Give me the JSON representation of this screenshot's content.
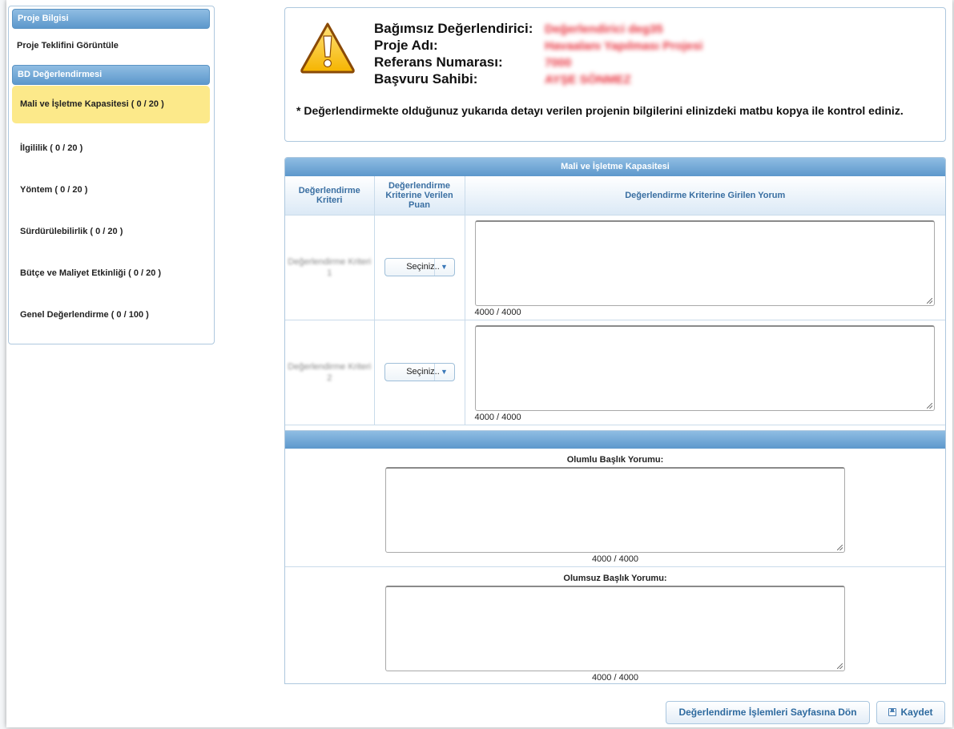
{
  "sidebar": {
    "section1_title": "Proje Bilgisi",
    "view_proposal_link": "Proje Teklifini Görüntüle",
    "section2_title": "BD Değerlendirmesi",
    "items": [
      {
        "label": "Mali ve İşletme Kapasitesi ( 0 / 20 )",
        "active": true
      },
      {
        "label": "İlgililik ( 0 / 20 )"
      },
      {
        "label": "Yöntem ( 0 / 20 )"
      },
      {
        "label": "Sürdürülebilirlik ( 0 / 20 )"
      },
      {
        "label": "Bütçe ve Maliyet Etkinliği ( 0 / 20 )"
      },
      {
        "label": "Genel Değerlendirme ( 0 / 100 )"
      }
    ]
  },
  "info": {
    "evaluator_label": "Bağımsız Değerlendirici:",
    "evaluator_value": "Değerlendirici deg35",
    "project_label": "Proje Adı:",
    "project_value": "Havaalanı Yapılması Projesi",
    "ref_label": "Referans Numarası:",
    "ref_value": "7000",
    "applicant_label": "Başvuru Sahibi:",
    "applicant_value": "AYŞE SÖNMEZ",
    "note": "* Değerlendirmekte olduğunuz yukarıda detayı verilen projenin bilgilerini elinizdeki matbu kopya ile kontrol ediniz."
  },
  "criteria": {
    "title": "Mali ve İşletme Kapasitesi",
    "col_criterion": "Değerlendirme Kriteri",
    "col_score": "Değerlendirme Kriterine Verilen Puan",
    "col_comment": "Değerlendirme Kriterine Girilen Yorum",
    "rows": [
      {
        "name": "Değerlendirme Kriteri 1",
        "select": "Seçiniz..",
        "counter": "4000 / 4000"
      },
      {
        "name": "Değerlendirme Kriteri 2",
        "select": "Seçiniz..",
        "counter": "4000 / 4000"
      }
    ]
  },
  "summary": {
    "positive_label": "Olumlu Başlık Yorumu:",
    "positive_counter": "4000 / 4000",
    "negative_label": "Olumsuz Başlık Yorumu:",
    "negative_counter": "4000 / 4000"
  },
  "buttons": {
    "back": "Değerlendirme İşlemleri Sayfasına Dön",
    "save": "Kaydet"
  },
  "colors": {
    "accent": "#5d98cc",
    "active_item": "#fce98a",
    "redacted": "#e8323e"
  }
}
